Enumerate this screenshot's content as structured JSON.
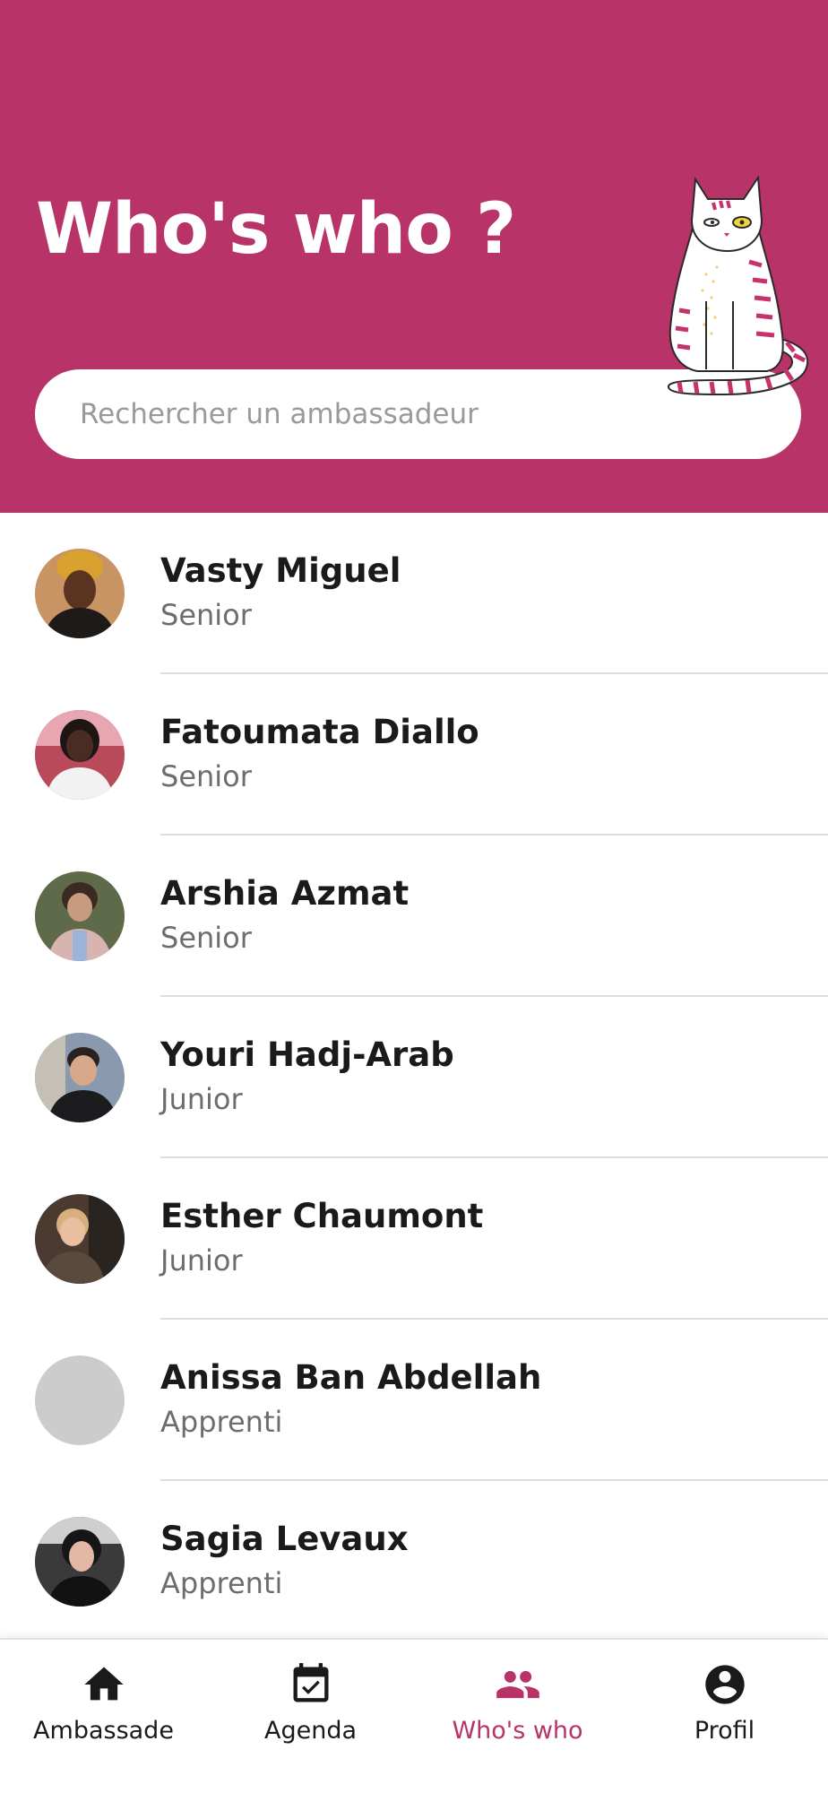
{
  "header": {
    "title": "Who's who ?",
    "background_color": "#b83367",
    "illustration": "sitting-cat-illustration"
  },
  "search": {
    "placeholder": "Rechercher un ambassadeur",
    "value": ""
  },
  "ambassadors": [
    {
      "name": "Vasty Miguel",
      "level": "Senior",
      "avatar": "photo"
    },
    {
      "name": "Fatoumata Diallo",
      "level": "Senior",
      "avatar": "photo"
    },
    {
      "name": "Arshia Azmat",
      "level": "Senior",
      "avatar": "photo"
    },
    {
      "name": "Youri Hadj-Arab",
      "level": "Junior",
      "avatar": "photo"
    },
    {
      "name": "Esther Chaumont",
      "level": "Junior",
      "avatar": "photo"
    },
    {
      "name": "Anissa Ban Abdellah",
      "level": "Apprenti",
      "avatar": "placeholder"
    },
    {
      "name": "Sagia Levaux",
      "level": "Apprenti",
      "avatar": "photo"
    }
  ],
  "bottom_nav": {
    "active_color": "#b83367",
    "items": [
      {
        "label": "Ambassade",
        "icon": "home-icon",
        "active": false
      },
      {
        "label": "Agenda",
        "icon": "calendar-check-icon",
        "active": false
      },
      {
        "label": "Who's who",
        "icon": "people-icon",
        "active": true
      },
      {
        "label": "Profil",
        "icon": "account-circle-icon",
        "active": false
      }
    ]
  }
}
